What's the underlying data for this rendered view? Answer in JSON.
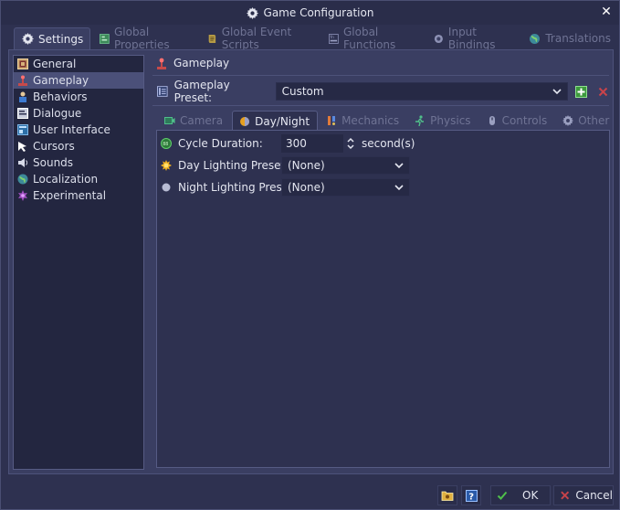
{
  "window": {
    "title": "Game Configuration"
  },
  "top_tabs": [
    {
      "label": "Settings",
      "active": true
    },
    {
      "label": "Global Properties",
      "active": false
    },
    {
      "label": "Global Event Scripts",
      "active": false
    },
    {
      "label": "Global Functions",
      "active": false
    },
    {
      "label": "Input Bindings",
      "active": false
    },
    {
      "label": "Translations",
      "active": false
    }
  ],
  "sidebar": {
    "items": [
      {
        "label": "General"
      },
      {
        "label": "Gameplay",
        "active": true
      },
      {
        "label": "Behaviors"
      },
      {
        "label": "Dialogue"
      },
      {
        "label": "User Interface"
      },
      {
        "label": "Cursors"
      },
      {
        "label": "Sounds"
      },
      {
        "label": "Localization"
      },
      {
        "label": "Experimental"
      }
    ]
  },
  "section": {
    "title": "Gameplay",
    "preset_label": "Gameplay Preset:",
    "preset_value": "Custom"
  },
  "sub_tabs": [
    {
      "label": "Camera",
      "active": false
    },
    {
      "label": "Day/Night",
      "active": true
    },
    {
      "label": "Mechanics",
      "active": false
    },
    {
      "label": "Physics",
      "active": false
    },
    {
      "label": "Controls",
      "active": false
    },
    {
      "label": "Other",
      "active": false
    }
  ],
  "fields": {
    "cycle_duration": {
      "label": "Cycle Duration:",
      "value": "300",
      "unit": "second(s)"
    },
    "day_lighting": {
      "label": "Day Lighting Preset:",
      "value": "(None)"
    },
    "night_lighting": {
      "label": "Night Lighting Preset:",
      "value": "(None)"
    }
  },
  "buttons": {
    "ok": "OK",
    "cancel": "Cancel"
  },
  "colors": {
    "accent_green": "#4fbf4a",
    "danger_red": "#c8434a",
    "bg": "#2e3150"
  }
}
